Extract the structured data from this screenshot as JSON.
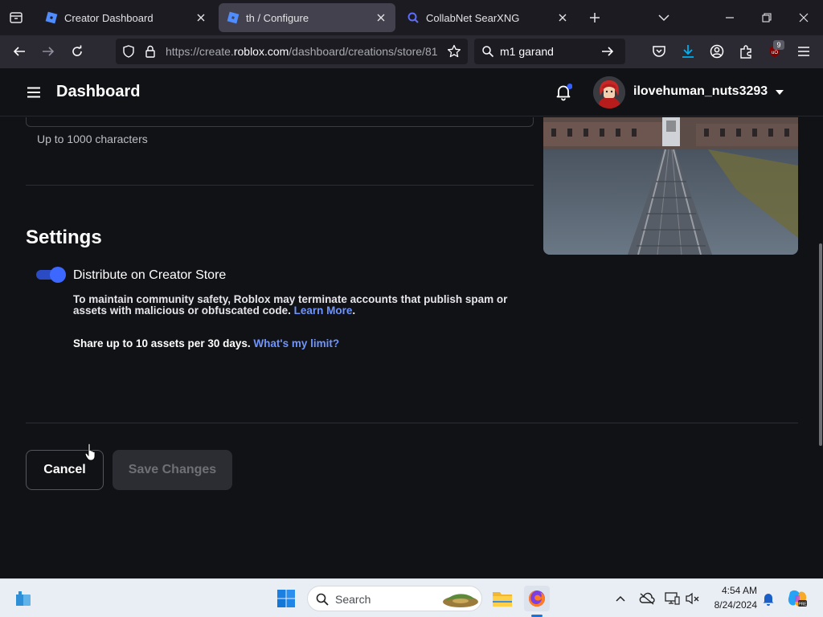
{
  "browser": {
    "tabs": [
      {
        "title": "Creator Dashboard",
        "active": false,
        "icon": "roblox-logo-icon"
      },
      {
        "title": "th / Configure",
        "active": true,
        "icon": "roblox-logo-icon"
      },
      {
        "title": "CollabNet SearXNG",
        "active": false,
        "icon": "searxng-icon"
      }
    ],
    "url_prefix": "https://create.",
    "url_domain": "roblox.com",
    "url_path": "/dashboard/creations/store/81",
    "search_query": "m1 garand",
    "extensions_badge": "9"
  },
  "header": {
    "title": "Dashboard",
    "username": "ilovehuman_nuts3293",
    "notification_dot_color": "#335fff"
  },
  "form": {
    "char_hint": "Up to 1000 characters",
    "settings_title": "Settings",
    "distribute_label": "Distribute on Creator Store",
    "distribute_enabled": true,
    "safety_text": "To maintain community safety, Roblox may terminate accounts that publish spam or assets with malicious or obfuscated code.",
    "learn_more": "Learn More",
    "share_text": "Share up to 10 assets per 30 days.",
    "limit_link": "What's my limit?",
    "cancel_label": "Cancel",
    "save_label": "Save Changes"
  },
  "taskbar": {
    "search_placeholder": "Search",
    "time": "4:54 AM",
    "date": "8/24/2024"
  },
  "colors": {
    "accent": "#335fff",
    "link": "#6e95ff",
    "background": "#111216"
  }
}
